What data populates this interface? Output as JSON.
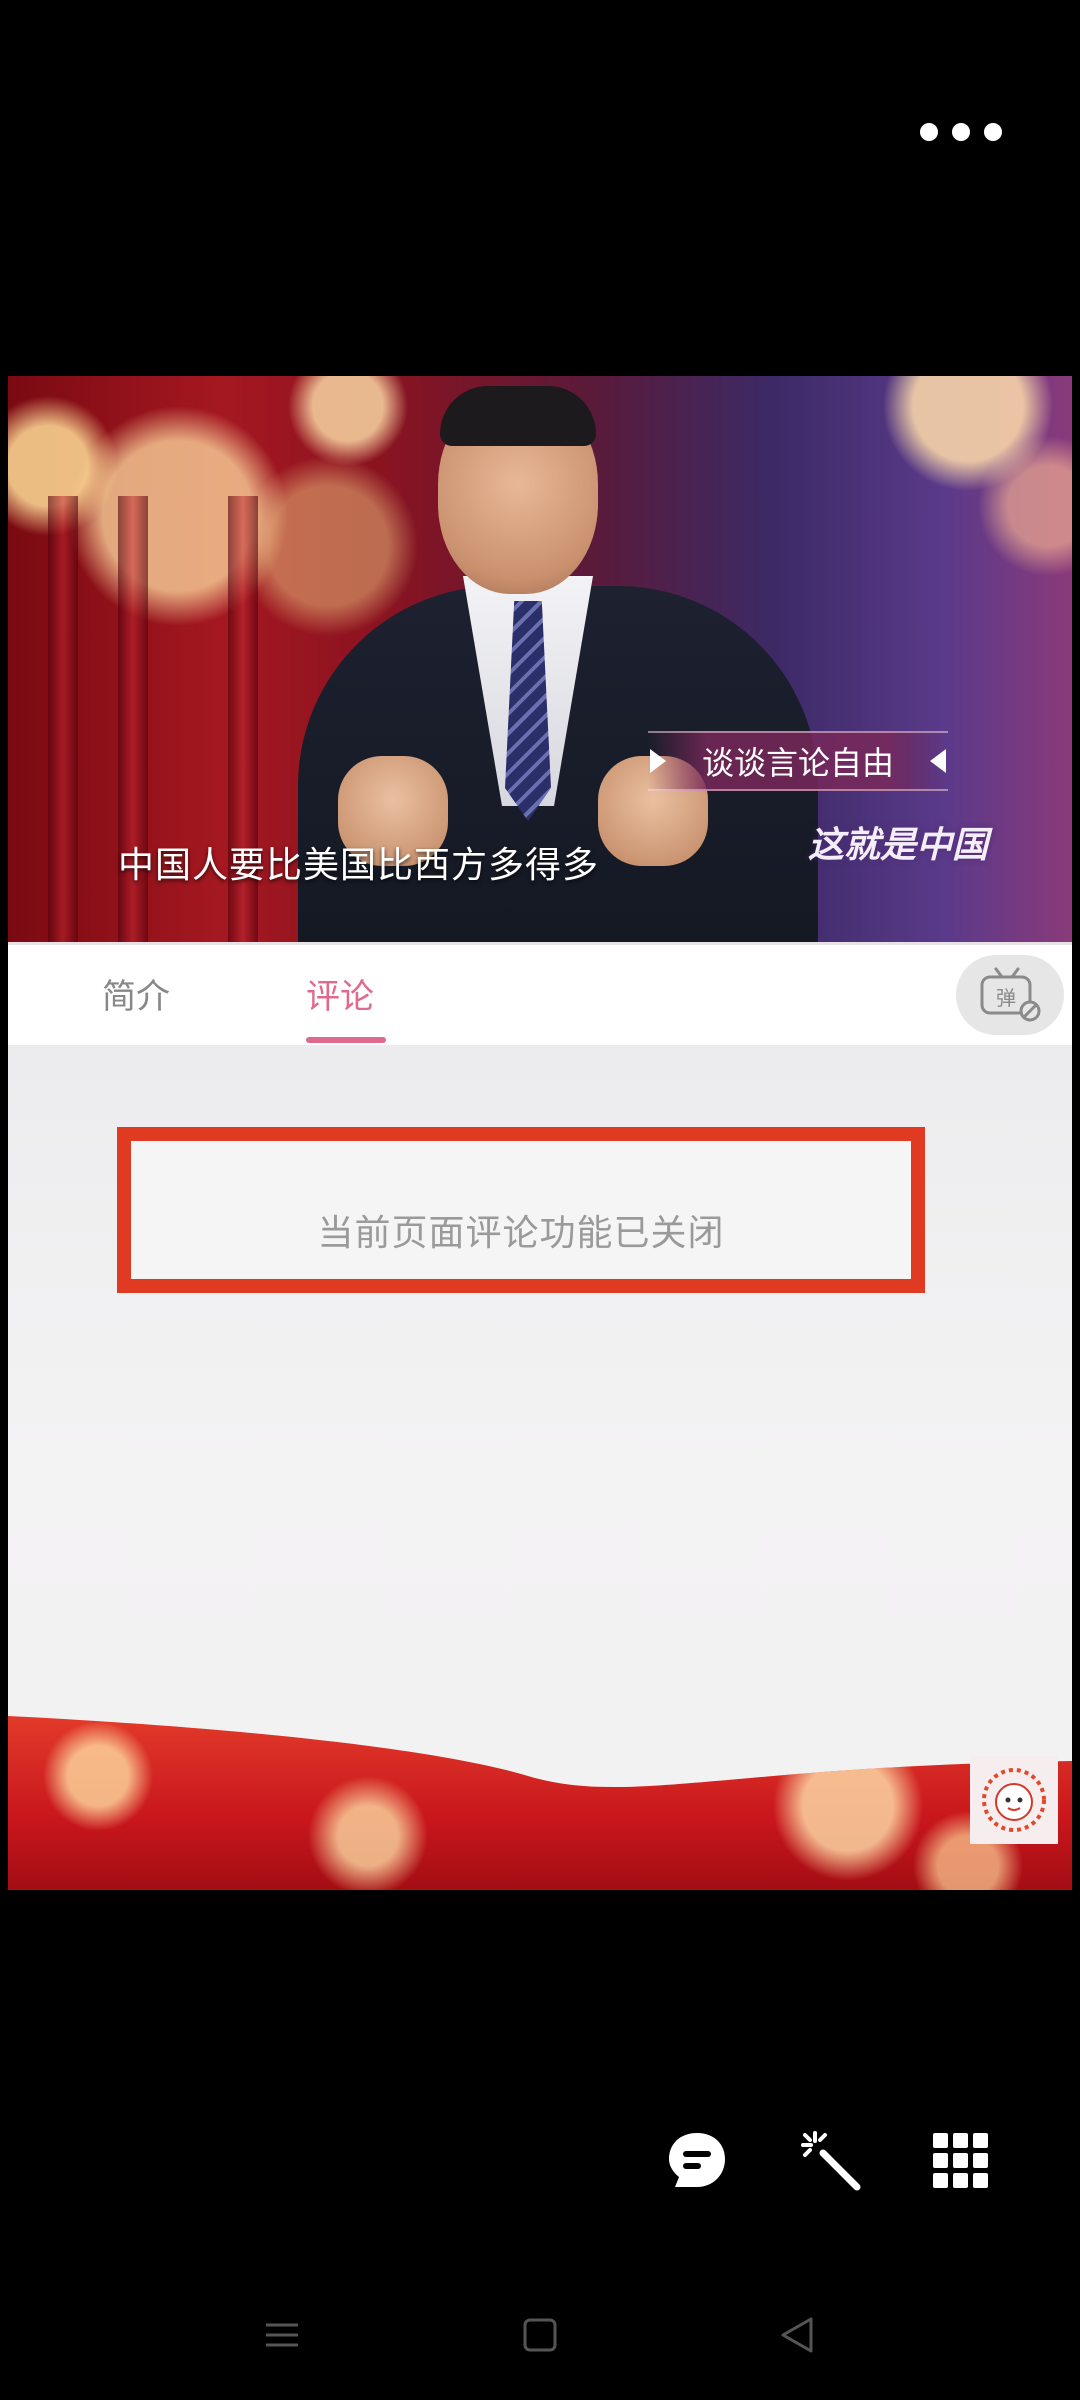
{
  "header": {
    "more_icon": "more-dots-icon"
  },
  "video": {
    "caption": "中国人要比美国比西方多得多",
    "topic_banner": "谈谈言论自由",
    "show_logo": "这就是中国"
  },
  "tabs": [
    {
      "label": "简介",
      "active": false
    },
    {
      "label": "评论",
      "active": true
    }
  ],
  "accent_color": "#e06a8e",
  "danmaku_icon": "danmaku-off-icon",
  "comments": {
    "closed_message": "当前页面评论功能已关闭",
    "highlight_color": "#e03a22"
  },
  "toolbar": {
    "items": [
      "chat-icon",
      "magic-wand-icon",
      "grid-apps-icon"
    ]
  },
  "navbar": {
    "items": [
      "menu-icon",
      "home-icon",
      "back-icon"
    ]
  }
}
